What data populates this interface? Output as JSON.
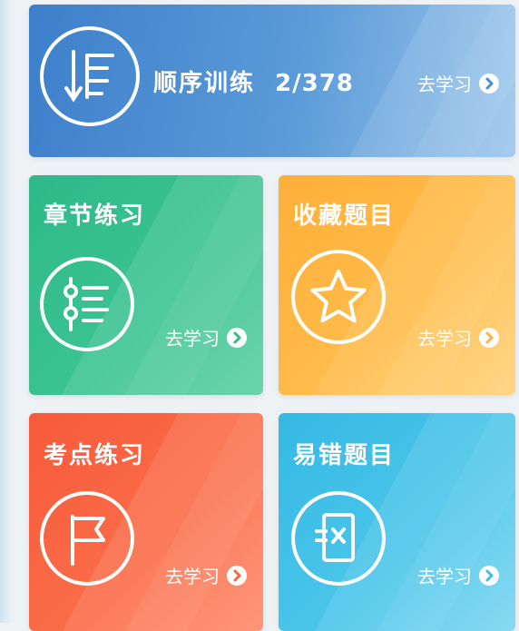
{
  "sequential": {
    "title": "顺序训练",
    "progress": "2/378",
    "action": "去学习",
    "icon": "sort-list-icon"
  },
  "chapter": {
    "title": "章节练习",
    "action": "去学习",
    "icon": "chapter-list-icon"
  },
  "favorites": {
    "title": "收藏题目",
    "action": "去学习",
    "icon": "star-icon"
  },
  "keypoints": {
    "title": "考点练习",
    "action": "去学习",
    "icon": "flag-icon"
  },
  "mistakes": {
    "title": "易错题目",
    "action": "去学习",
    "icon": "error-card-icon"
  },
  "colors": {
    "sequential": "#4a8bd0",
    "chapter": "#33bb8c",
    "favorites": "#ffb340",
    "keypoints": "#f7623f",
    "mistakes": "#3fbfe7"
  }
}
